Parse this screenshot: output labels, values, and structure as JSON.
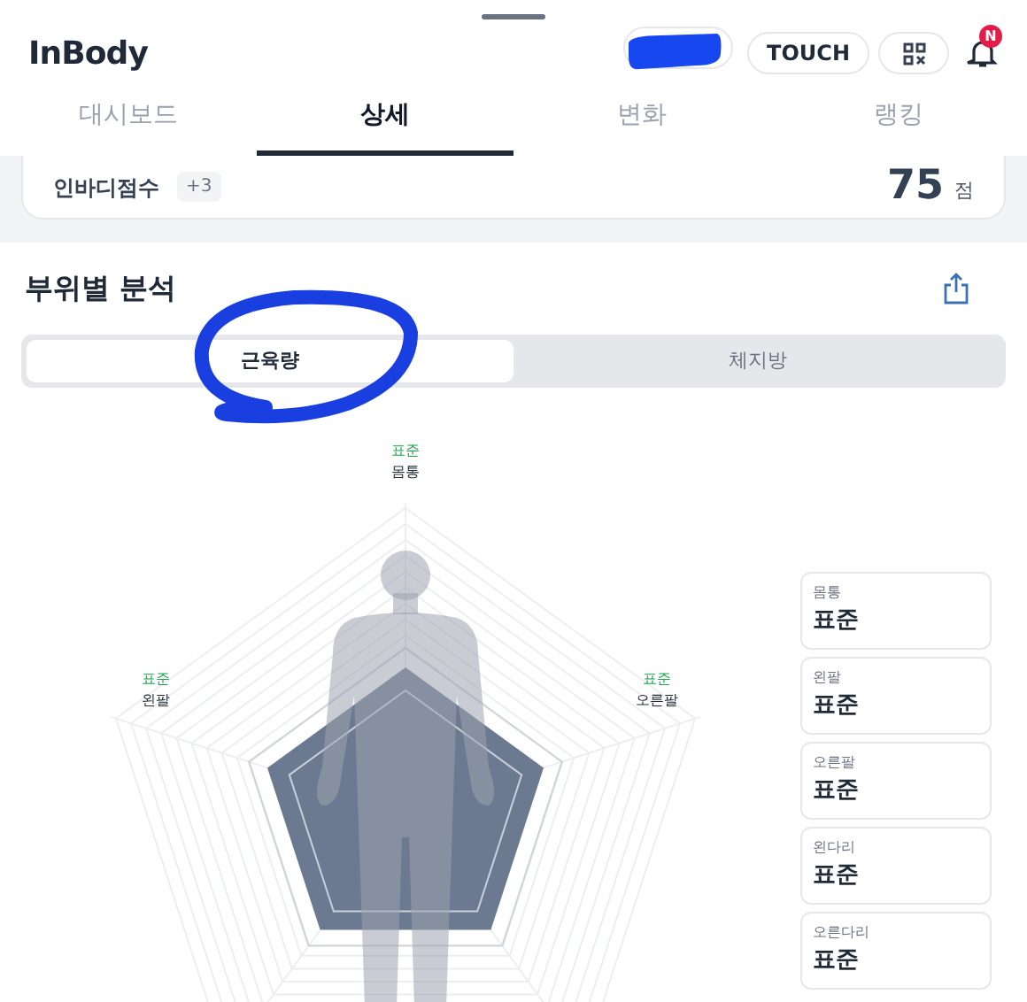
{
  "header": {
    "logo": "InBody",
    "touch_button": "TOUCH",
    "notification_badge": "N"
  },
  "tabs": [
    {
      "label": "대시보드",
      "selected": false
    },
    {
      "label": "상세",
      "selected": true
    },
    {
      "label": "변화",
      "selected": false
    },
    {
      "label": "랭킹",
      "selected": false
    }
  ],
  "score_card": {
    "label": "인바디점수",
    "change": "+3",
    "score": "75",
    "unit": "점"
  },
  "section": {
    "title": "부위별 분석",
    "segments": [
      {
        "label": "근육량",
        "selected": true
      },
      {
        "label": "체지방",
        "selected": false
      }
    ],
    "radar_labels": [
      {
        "status": "표준",
        "part": "몸통"
      },
      {
        "status": "표준",
        "part": "왼팔"
      },
      {
        "status": "표준",
        "part": "오른팔"
      }
    ],
    "cards": [
      {
        "part": "몸통",
        "status": "표준"
      },
      {
        "part": "왼팔",
        "status": "표준"
      },
      {
        "part": "오른팔",
        "status": "표준"
      },
      {
        "part": "왼다리",
        "status": "표준"
      },
      {
        "part": "오른다리",
        "status": "표준"
      }
    ]
  }
}
